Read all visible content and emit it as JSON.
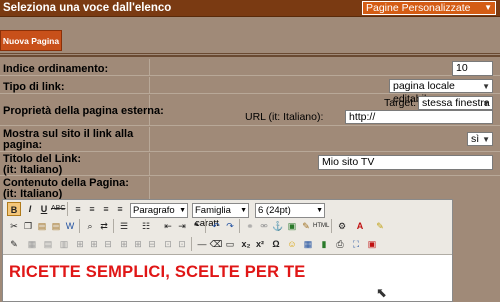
{
  "header": {
    "title": "Seleziona una voce dall'elenco",
    "select_value": "Pagine Personalizzate"
  },
  "toolbar_main": {
    "new_page_label": "Nuova Pagina"
  },
  "form": {
    "ordering_label": "Indice ordinamento:",
    "ordering_value": "10",
    "link_type_label": "Tipo di link:",
    "link_type_value": "pagina locale editabile",
    "external_label": "Proprietà della pagina esterna:",
    "target_label": "Target:",
    "target_value": "stessa finestra",
    "url_label": "URL (it: Italiano):",
    "url_value": "http://",
    "show_link_label_1": "Mostra sul sito il link alla",
    "show_link_label_2": "pagina:",
    "show_link_value": "sì",
    "link_title_label_1": "Titolo del Link:",
    "link_title_label_2": "(it: Italiano)",
    "link_title_value": "Mio sito TV",
    "content_label_1": "Contenuto della Pagina:",
    "content_label_2": "(it: Italiano)"
  },
  "editor": {
    "format_value": "Paragrafo",
    "font_family_value": "Famiglia caratt",
    "font_size_value": "6 (24pt)",
    "content_text": "RICETTE SEMPLICI, SCELTE PER TE"
  }
}
